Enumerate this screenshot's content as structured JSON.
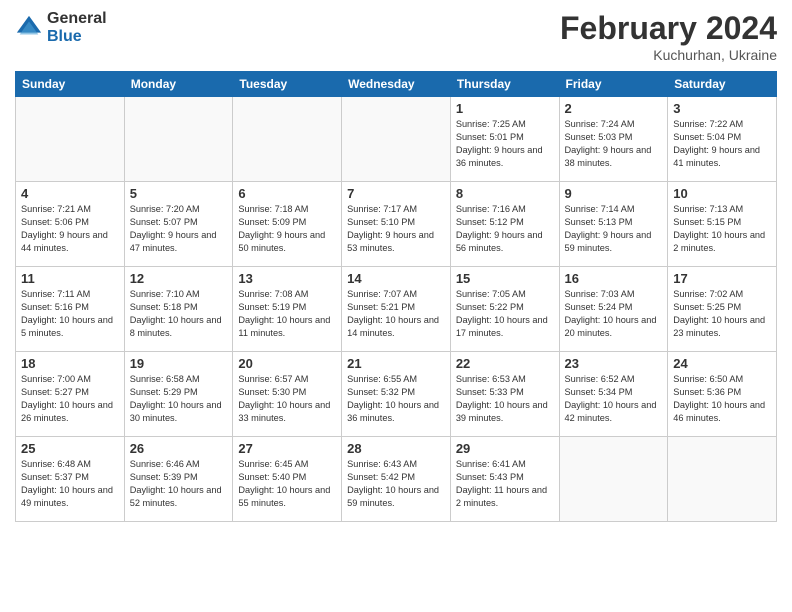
{
  "logo": {
    "general": "General",
    "blue": "Blue"
  },
  "header": {
    "month": "February 2024",
    "location": "Kuchurhan, Ukraine"
  },
  "weekdays": [
    "Sunday",
    "Monday",
    "Tuesday",
    "Wednesday",
    "Thursday",
    "Friday",
    "Saturday"
  ],
  "weeks": [
    [
      {
        "day": "",
        "sunrise": "",
        "sunset": "",
        "daylight": "",
        "empty": true
      },
      {
        "day": "",
        "sunrise": "",
        "sunset": "",
        "daylight": "",
        "empty": true
      },
      {
        "day": "",
        "sunrise": "",
        "sunset": "",
        "daylight": "",
        "empty": true
      },
      {
        "day": "",
        "sunrise": "",
        "sunset": "",
        "daylight": "",
        "empty": true
      },
      {
        "day": "1",
        "sunrise": "7:25 AM",
        "sunset": "5:01 PM",
        "daylight": "9 hours and 36 minutes."
      },
      {
        "day": "2",
        "sunrise": "7:24 AM",
        "sunset": "5:03 PM",
        "daylight": "9 hours and 38 minutes."
      },
      {
        "day": "3",
        "sunrise": "7:22 AM",
        "sunset": "5:04 PM",
        "daylight": "9 hours and 41 minutes."
      }
    ],
    [
      {
        "day": "4",
        "sunrise": "7:21 AM",
        "sunset": "5:06 PM",
        "daylight": "9 hours and 44 minutes."
      },
      {
        "day": "5",
        "sunrise": "7:20 AM",
        "sunset": "5:07 PM",
        "daylight": "9 hours and 47 minutes."
      },
      {
        "day": "6",
        "sunrise": "7:18 AM",
        "sunset": "5:09 PM",
        "daylight": "9 hours and 50 minutes."
      },
      {
        "day": "7",
        "sunrise": "7:17 AM",
        "sunset": "5:10 PM",
        "daylight": "9 hours and 53 minutes."
      },
      {
        "day": "8",
        "sunrise": "7:16 AM",
        "sunset": "5:12 PM",
        "daylight": "9 hours and 56 minutes."
      },
      {
        "day": "9",
        "sunrise": "7:14 AM",
        "sunset": "5:13 PM",
        "daylight": "9 hours and 59 minutes."
      },
      {
        "day": "10",
        "sunrise": "7:13 AM",
        "sunset": "5:15 PM",
        "daylight": "10 hours and 2 minutes."
      }
    ],
    [
      {
        "day": "11",
        "sunrise": "7:11 AM",
        "sunset": "5:16 PM",
        "daylight": "10 hours and 5 minutes."
      },
      {
        "day": "12",
        "sunrise": "7:10 AM",
        "sunset": "5:18 PM",
        "daylight": "10 hours and 8 minutes."
      },
      {
        "day": "13",
        "sunrise": "7:08 AM",
        "sunset": "5:19 PM",
        "daylight": "10 hours and 11 minutes."
      },
      {
        "day": "14",
        "sunrise": "7:07 AM",
        "sunset": "5:21 PM",
        "daylight": "10 hours and 14 minutes."
      },
      {
        "day": "15",
        "sunrise": "7:05 AM",
        "sunset": "5:22 PM",
        "daylight": "10 hours and 17 minutes."
      },
      {
        "day": "16",
        "sunrise": "7:03 AM",
        "sunset": "5:24 PM",
        "daylight": "10 hours and 20 minutes."
      },
      {
        "day": "17",
        "sunrise": "7:02 AM",
        "sunset": "5:25 PM",
        "daylight": "10 hours and 23 minutes."
      }
    ],
    [
      {
        "day": "18",
        "sunrise": "7:00 AM",
        "sunset": "5:27 PM",
        "daylight": "10 hours and 26 minutes."
      },
      {
        "day": "19",
        "sunrise": "6:58 AM",
        "sunset": "5:29 PM",
        "daylight": "10 hours and 30 minutes."
      },
      {
        "day": "20",
        "sunrise": "6:57 AM",
        "sunset": "5:30 PM",
        "daylight": "10 hours and 33 minutes."
      },
      {
        "day": "21",
        "sunrise": "6:55 AM",
        "sunset": "5:32 PM",
        "daylight": "10 hours and 36 minutes."
      },
      {
        "day": "22",
        "sunrise": "6:53 AM",
        "sunset": "5:33 PM",
        "daylight": "10 hours and 39 minutes."
      },
      {
        "day": "23",
        "sunrise": "6:52 AM",
        "sunset": "5:34 PM",
        "daylight": "10 hours and 42 minutes."
      },
      {
        "day": "24",
        "sunrise": "6:50 AM",
        "sunset": "5:36 PM",
        "daylight": "10 hours and 46 minutes."
      }
    ],
    [
      {
        "day": "25",
        "sunrise": "6:48 AM",
        "sunset": "5:37 PM",
        "daylight": "10 hours and 49 minutes."
      },
      {
        "day": "26",
        "sunrise": "6:46 AM",
        "sunset": "5:39 PM",
        "daylight": "10 hours and 52 minutes."
      },
      {
        "day": "27",
        "sunrise": "6:45 AM",
        "sunset": "5:40 PM",
        "daylight": "10 hours and 55 minutes."
      },
      {
        "day": "28",
        "sunrise": "6:43 AM",
        "sunset": "5:42 PM",
        "daylight": "10 hours and 59 minutes."
      },
      {
        "day": "29",
        "sunrise": "6:41 AM",
        "sunset": "5:43 PM",
        "daylight": "11 hours and 2 minutes."
      },
      {
        "day": "",
        "sunrise": "",
        "sunset": "",
        "daylight": "",
        "empty": true
      },
      {
        "day": "",
        "sunrise": "",
        "sunset": "",
        "daylight": "",
        "empty": true
      }
    ]
  ]
}
